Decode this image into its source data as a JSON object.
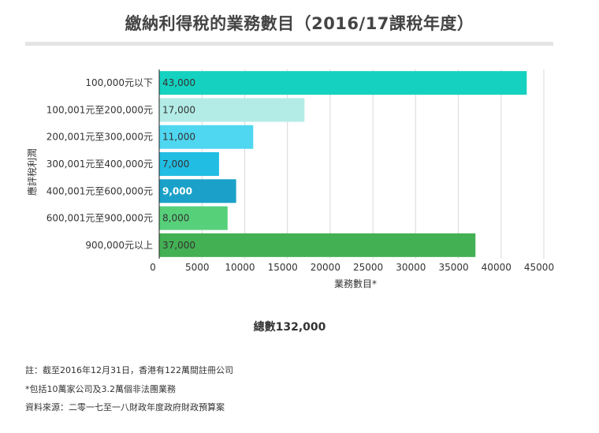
{
  "title": "繳納利得稅的業務數目（2016/17課稅年度）",
  "total_label": "總數132,000",
  "notes": [
    "註：截至2016年12月31日，香港有122萬間註冊公司",
    "*包括10萬家公司及3.2萬個非法團業務",
    "資料來源：二零一七至一八財政年度政府財政預算案"
  ],
  "chart_data": {
    "type": "bar",
    "orientation": "horizontal",
    "title": "繳納利得稅的業務數目（2016/17課稅年度）",
    "xlabel": "業務數目*",
    "ylabel": "應評稅利潤",
    "categories": [
      "100,000元以下",
      "100,001元至200,000元",
      "200,001元至300,000元",
      "300,001元至400,000元",
      "400,001元至600,000元",
      "600,001元至900,000元",
      "900,000元以上"
    ],
    "values": [
      43000,
      17000,
      11000,
      7000,
      9000,
      8000,
      37000
    ],
    "value_labels": [
      "43,000",
      "17,000",
      "11,000",
      "7,000",
      "9,000",
      "8,000",
      "37,000"
    ],
    "colors": [
      "#15d1c0",
      "#b3ece6",
      "#4fd6f0",
      "#21bde3",
      "#1ba1c9",
      "#57d07a",
      "#43b054"
    ],
    "label_colors": [
      "#333333",
      "#333333",
      "#333333",
      "#333333",
      "#ffffff",
      "#333333",
      "#333333"
    ],
    "xlim": [
      0,
      45000
    ],
    "xticks": [
      0,
      5000,
      10000,
      15000,
      20000,
      25000,
      30000,
      35000,
      40000,
      45000
    ],
    "xtick_labels": [
      "0",
      "5000",
      "10000",
      "15000",
      "20000",
      "25000",
      "30000",
      "35000",
      "40000",
      "45000"
    ],
    "grid": true
  }
}
